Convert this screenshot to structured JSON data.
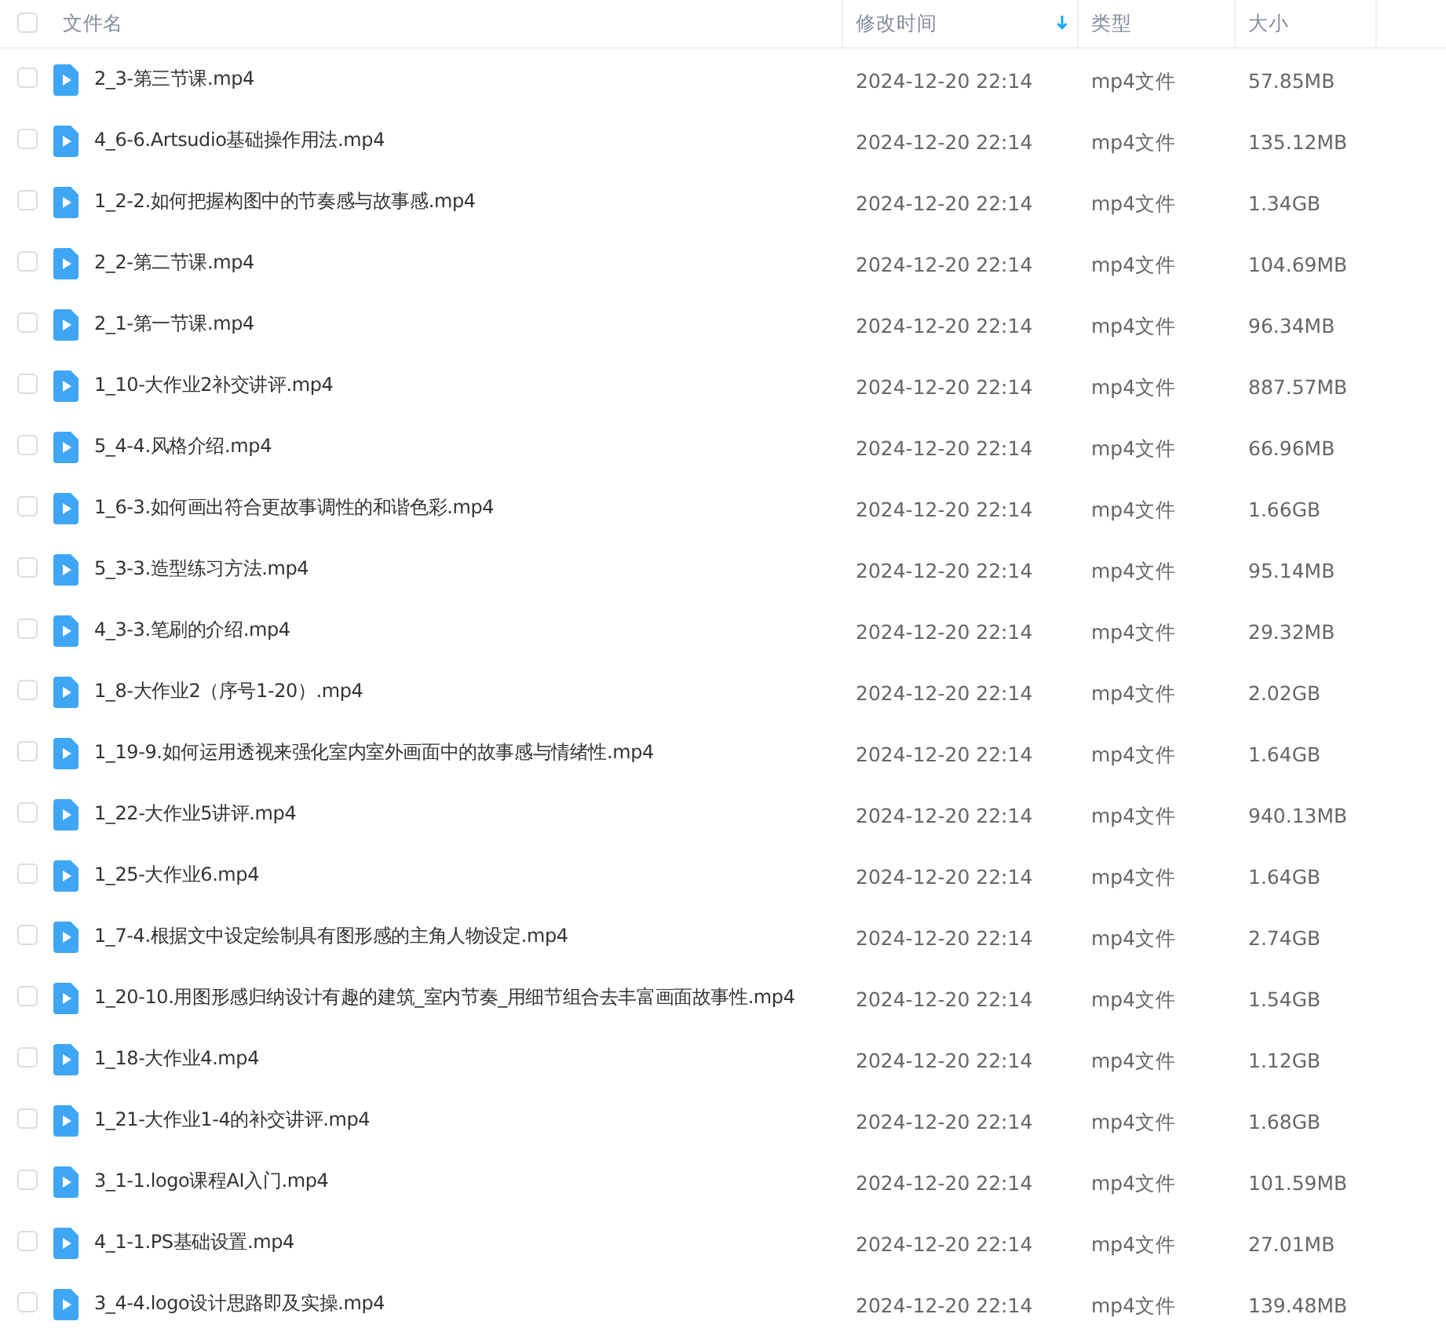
{
  "header": {
    "select_all": {
      "checked": false
    },
    "columns": [
      {
        "label": "文件名",
        "sorted": false
      },
      {
        "label": "修改时间",
        "sorted": true
      },
      {
        "label": "类型",
        "sorted": false
      },
      {
        "label": "大小",
        "sorted": false
      }
    ]
  },
  "rows": [
    {
      "name": "2_3-第三节课.mp4",
      "modified": "2024-12-20 22:14",
      "type": "mp4文件",
      "size": "57.85MB",
      "checked": false
    },
    {
      "name": "4_6-6.Artsudio基础操作用法.mp4",
      "modified": "2024-12-20 22:14",
      "type": "mp4文件",
      "size": "135.12MB",
      "checked": false
    },
    {
      "name": "1_2-2.如何把握构图中的节奏感与故事感.mp4",
      "modified": "2024-12-20 22:14",
      "type": "mp4文件",
      "size": "1.34GB",
      "checked": false
    },
    {
      "name": "2_2-第二节课.mp4",
      "modified": "2024-12-20 22:14",
      "type": "mp4文件",
      "size": "104.69MB",
      "checked": false
    },
    {
      "name": "2_1-第一节课.mp4",
      "modified": "2024-12-20 22:14",
      "type": "mp4文件",
      "size": "96.34MB",
      "checked": false
    },
    {
      "name": "1_10-大作业2补交讲评.mp4",
      "modified": "2024-12-20 22:14",
      "type": "mp4文件",
      "size": "887.57MB",
      "checked": false
    },
    {
      "name": "5_4-4.风格介绍.mp4",
      "modified": "2024-12-20 22:14",
      "type": "mp4文件",
      "size": "66.96MB",
      "checked": false
    },
    {
      "name": "1_6-3.如何画出符合更故事调性的和谐色彩.mp4",
      "modified": "2024-12-20 22:14",
      "type": "mp4文件",
      "size": "1.66GB",
      "checked": false
    },
    {
      "name": "5_3-3.造型练习方法.mp4",
      "modified": "2024-12-20 22:14",
      "type": "mp4文件",
      "size": "95.14MB",
      "checked": false
    },
    {
      "name": "4_3-3.笔刷的介绍.mp4",
      "modified": "2024-12-20 22:14",
      "type": "mp4文件",
      "size": "29.32MB",
      "checked": false
    },
    {
      "name": "1_8-大作业2（序号1-20）.mp4",
      "modified": "2024-12-20 22:14",
      "type": "mp4文件",
      "size": "2.02GB",
      "checked": false
    },
    {
      "name": "1_19-9.如何运用透视来强化室内室外画面中的故事感与情绪性.mp4",
      "modified": "2024-12-20 22:14",
      "type": "mp4文件",
      "size": "1.64GB",
      "checked": false
    },
    {
      "name": "1_22-大作业5讲评.mp4",
      "modified": "2024-12-20 22:14",
      "type": "mp4文件",
      "size": "940.13MB",
      "checked": false
    },
    {
      "name": "1_25-大作业6.mp4",
      "modified": "2024-12-20 22:14",
      "type": "mp4文件",
      "size": "1.64GB",
      "checked": false
    },
    {
      "name": "1_7-4.根据文中设定绘制具有图形感的主角人物设定.mp4",
      "modified": "2024-12-20 22:14",
      "type": "mp4文件",
      "size": "2.74GB",
      "checked": false
    },
    {
      "name": "1_20-10.用图形感归纳设计有趣的建筑_室内节奏_用细节组合去丰富画面故事性.mp4",
      "modified": "2024-12-20 22:14",
      "type": "mp4文件",
      "size": "1.54GB",
      "checked": false
    },
    {
      "name": "1_18-大作业4.mp4",
      "modified": "2024-12-20 22:14",
      "type": "mp4文件",
      "size": "1.12GB",
      "checked": false
    },
    {
      "name": "1_21-大作业1-4的补交讲评.mp4",
      "modified": "2024-12-20 22:14",
      "type": "mp4文件",
      "size": "1.68GB",
      "checked": false
    },
    {
      "name": "3_1-1.logo课程AI入门.mp4",
      "modified": "2024-12-20 22:14",
      "type": "mp4文件",
      "size": "101.59MB",
      "checked": false
    },
    {
      "name": "4_1-1.PS基础设置.mp4",
      "modified": "2024-12-20 22:14",
      "type": "mp4文件",
      "size": "27.01MB",
      "checked": false
    },
    {
      "name": "3_4-4.logo设计思路即及实操.mp4",
      "modified": "2024-12-20 22:14",
      "type": "mp4文件",
      "size": "139.48MB",
      "checked": false
    }
  ]
}
